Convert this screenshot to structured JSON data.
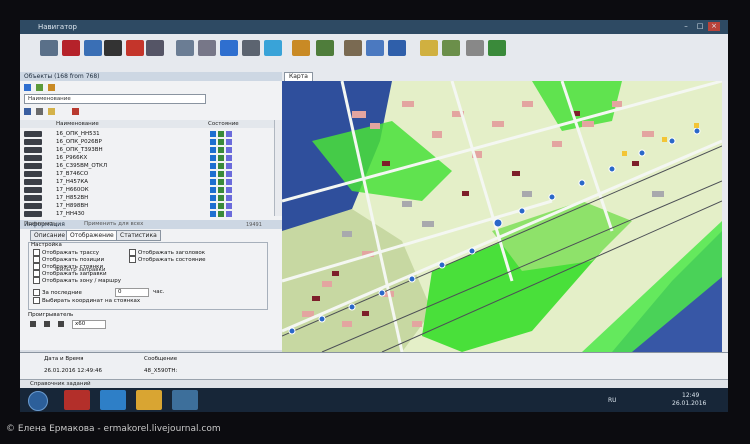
{
  "window": {
    "title": "Навигатор"
  },
  "objects_panel": {
    "header": "Объекты (168 from 768)",
    "dropdown": "Наименование",
    "columns": {
      "name": "Наименование",
      "state": "Состояние"
    },
    "rows": [
      "16_ОПК_НН531",
      "16_ОПК_Р026ВР",
      "16_ОПК_Т393ВН",
      "16_Р966КХ",
      "16_С395ВМ_ОТКЛ",
      "17_В746СО",
      "17_Н457КА",
      "17_Н660ОК",
      "17_Н852ВН",
      "17_Н898ВН",
      "17_НН430"
    ]
  },
  "info_panel": {
    "header": "Информация",
    "apply_label": "Применить",
    "apply_all_label": "Применить для всех",
    "counter": "19491",
    "tabs": [
      "Описание",
      "Отображение",
      "Статистика"
    ],
    "section": "Настройка",
    "options_left": [
      "Отображать трассу",
      "Отображать позиции",
      "Отображать стоянки",
      "Отображать заправки",
      "Отображать зону / маршру"
    ],
    "options_right": [
      "Отображать заголовок",
      "Отображать состояние"
    ],
    "filter_label": "Фильтр заправки",
    "last_label": "За последние",
    "last_value": "0",
    "last_unit": "час.",
    "coords_label": "Выбирать координат на стоянках",
    "playback_label": "Проигрыватель",
    "speed": "x60"
  },
  "map": {
    "tab": "Карта"
  },
  "messages": {
    "columns": {
      "date": "Дата и Время",
      "message": "Сообщение"
    },
    "rows": [
      {
        "date": "26.01.2016 12:49:46",
        "message": "48_Х590ТН:"
      }
    ]
  },
  "status": {
    "text": "Справочник заданий"
  },
  "taskbar": {
    "lang": "RU",
    "time": "12:49",
    "date": "26.01.2016"
  },
  "credit": "© Елена Ермакова - ermakorel.livejournal.com",
  "colors": {
    "map_green": "#49e03a",
    "map_light": "#e4efc8",
    "road_white": "#f4f7f2",
    "water": "#2f4f9c",
    "title_bar": "#2e4a63"
  }
}
